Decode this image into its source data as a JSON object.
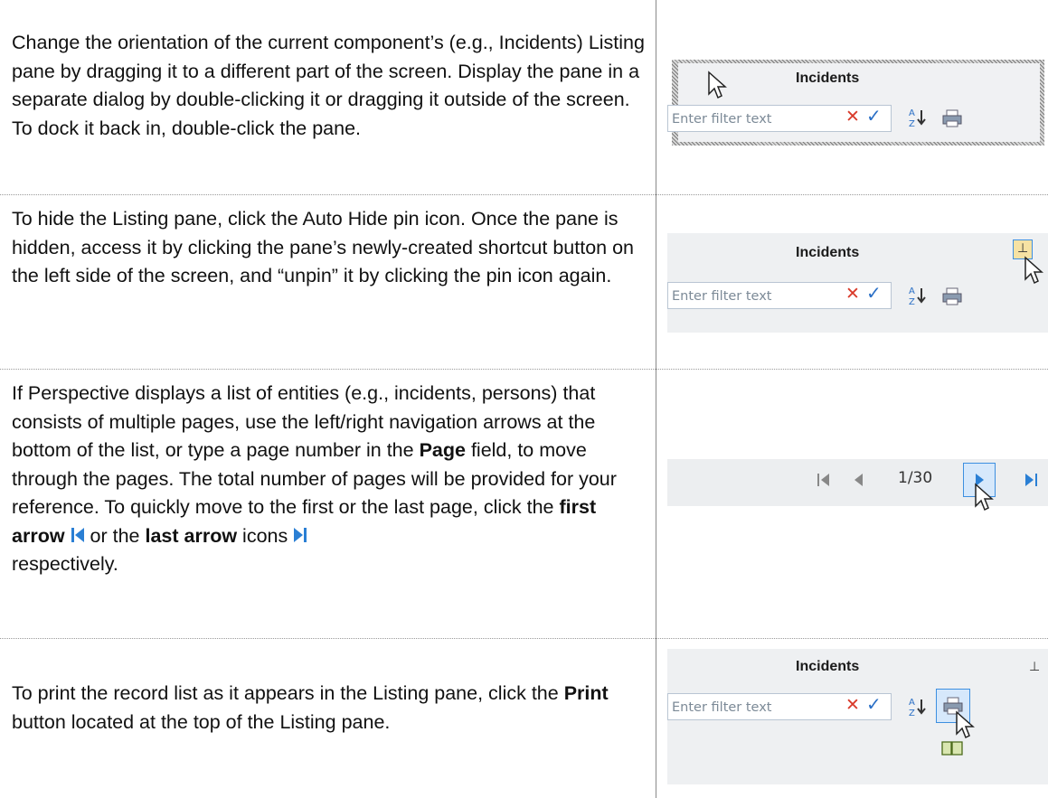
{
  "rows": [
    {
      "text": "Change the orientation of the current component’s (e.g., Incidents) Listing pane by dragging it to a different part of the screen. Display the pane in a separate dialog by double-clicking it or dragging it outside of the screen. To dock it back in, double-click the pane.",
      "pane_title": "Incidents",
      "filter_placeholder": "Enter filter text"
    },
    {
      "text": "To hide the Listing pane, click the Auto Hide pin icon. Once the pane is hidden, access it by clicking the pane’s newly-created shortcut button on the left side of the screen, and “unpin” it by clicking the pin icon again.",
      "pane_title": "Incidents",
      "filter_placeholder": "Enter filter text"
    },
    {
      "text_part1": "If Perspective displays a list of entities (e.g., incidents, persons) that consists of multiple pages, use the left/right navigation arrows at the bottom of the list, or type a page number in the ",
      "bold_page": "Page",
      "text_part2": " field, to move through the pages. The total number of pages will be provided for your reference. To quickly move to the first or the last page, click the ",
      "bold_first": "first arrow",
      "text_part3": " or the ",
      "bold_last": "last arrow",
      "text_part4": " icons",
      "text_part5": " respectively.",
      "page_indicator": "1/30"
    },
    {
      "text_part1": "To print the record list as it appears in the Listing pane, click the ",
      "bold_print": "Print",
      "text_part2": " button located at the top of the Listing pane.",
      "pane_title": "Incidents",
      "filter_placeholder": "Enter filter text"
    }
  ],
  "icons": [
    "x-clear-icon",
    "check-apply-icon",
    "sort-az-icon",
    "print-icon",
    "pin-icon",
    "first-page-icon",
    "previous-page-icon",
    "next-page-icon",
    "last-page-icon",
    "cursor-icon",
    "book-icon"
  ],
  "colors": {
    "x": "#d93a2a",
    "check": "#2a6fc6",
    "nav_arrow": "#2a7fd4",
    "highlight_border": "#3d8fe0",
    "pin_highlight": "#f6e2a3"
  }
}
